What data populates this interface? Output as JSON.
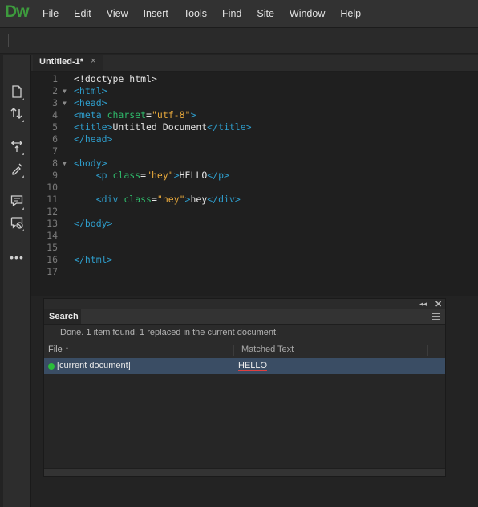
{
  "app": {
    "logo": "Dw"
  },
  "menu": [
    "File",
    "Edit",
    "View",
    "Insert",
    "Tools",
    "Find",
    "Site",
    "Window",
    "Help"
  ],
  "document_tab": {
    "title": "Untitled-1*",
    "close": "×"
  },
  "editor": {
    "lines": [
      {
        "n": "1",
        "fold": "",
        "html": "&lt;!doctype html&gt;"
      },
      {
        "n": "2",
        "fold": "▼",
        "html": "<span class=\"tag\">&lt;html&gt;</span>"
      },
      {
        "n": "3",
        "fold": "▼",
        "html": "<span class=\"tag\">&lt;head&gt;</span>"
      },
      {
        "n": "4",
        "fold": "",
        "html": "<span class=\"tag\">&lt;meta</span> <span class=\"attr\">charset</span>=<span class=\"str\">\"utf-8\"</span><span class=\"tag\">&gt;</span>"
      },
      {
        "n": "5",
        "fold": "",
        "html": "<span class=\"tag\">&lt;title&gt;</span>Untitled Document<span class=\"tag\">&lt;/title&gt;</span>"
      },
      {
        "n": "6",
        "fold": "",
        "html": "<span class=\"tag\">&lt;/head&gt;</span>"
      },
      {
        "n": "7",
        "fold": "",
        "html": ""
      },
      {
        "n": "8",
        "fold": "▼",
        "html": "<span class=\"tag\">&lt;body&gt;</span>"
      },
      {
        "n": "9",
        "fold": "",
        "html": "    <span class=\"tag\">&lt;p</span> <span class=\"attr\">class</span>=<span class=\"str\">\"hey\"</span><span class=\"tag\">&gt;</span>HELLO<span class=\"tag\">&lt;/p&gt;</span>"
      },
      {
        "n": "10",
        "fold": "",
        "html": ""
      },
      {
        "n": "11",
        "fold": "",
        "html": "    <span class=\"tag\">&lt;div</span> <span class=\"attr\">class</span>=<span class=\"str\">\"hey\"</span><span class=\"tag\">&gt;</span>hey<span class=\"tag\">&lt;/div&gt;</span>"
      },
      {
        "n": "12",
        "fold": "",
        "html": ""
      },
      {
        "n": "13",
        "fold": "",
        "html": "<span class=\"tag\">&lt;/body&gt;</span>"
      },
      {
        "n": "14",
        "fold": "",
        "html": ""
      },
      {
        "n": "15",
        "fold": "",
        "html": ""
      },
      {
        "n": "16",
        "fold": "",
        "html": "<span class=\"tag\">&lt;/html&gt;</span>"
      },
      {
        "n": "17",
        "fold": "",
        "html": ""
      }
    ]
  },
  "left_toolbar": {
    "icons": [
      "document-icon",
      "sort-icon",
      "expand-collapse-icon",
      "format-icon",
      "comment-icon",
      "remove-comment-icon",
      "more-icon"
    ]
  },
  "search_panel": {
    "collapse": "◂◂",
    "close": "✕",
    "tab": "Search",
    "status": "Done. 1 item found, 1 replaced in the current document.",
    "columns": {
      "file": "File ↑",
      "matched": "Matched Text"
    },
    "results": [
      {
        "file": "[current document]",
        "matched": "HELLO"
      }
    ]
  }
}
